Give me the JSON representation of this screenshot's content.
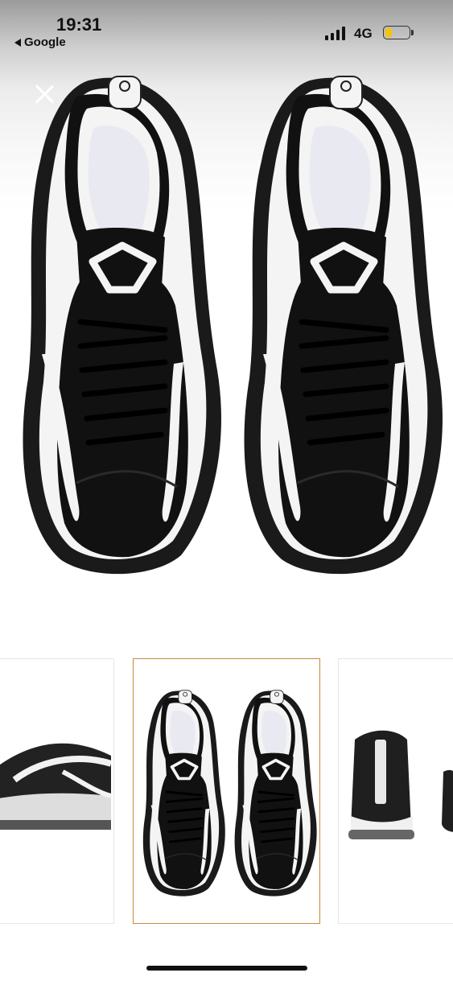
{
  "status_bar": {
    "time": "19:31",
    "back_app": "Google",
    "network": "4G",
    "battery_level": 0.3,
    "icons": [
      "back-arrow-icon",
      "signal-icon",
      "battery-icon"
    ]
  },
  "viewer": {
    "close_icon": "close-icon",
    "thumbnails": [
      {
        "name": "side-view",
        "selected": false
      },
      {
        "name": "top-view",
        "selected": true
      },
      {
        "name": "back-view",
        "selected": false
      }
    ],
    "selected_border_color": "#c8893e"
  },
  "colors": {
    "shoe_black": "#111111",
    "shoe_white": "#f4f4f4",
    "lining": "#e9eaf1"
  }
}
